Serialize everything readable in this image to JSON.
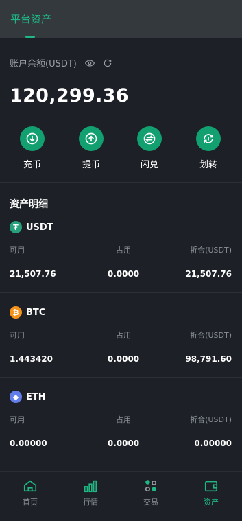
{
  "topbar": {
    "title": "平台资产"
  },
  "balance": {
    "label": "账户余额(USDT)",
    "amount": "120,299.36"
  },
  "actions": [
    {
      "label": "充币",
      "icon": "deposit-icon"
    },
    {
      "label": "提币",
      "icon": "withdraw-icon"
    },
    {
      "label": "闪兑",
      "icon": "swap-icon"
    },
    {
      "label": "划转",
      "icon": "transfer-icon"
    }
  ],
  "section": {
    "title": "资产明细"
  },
  "columns": {
    "available": "可用",
    "occupied": "占用",
    "converted": "折合(USDT)"
  },
  "assets": [
    {
      "symbol": "USDT",
      "color": "#26a17b",
      "glyph": "₮",
      "available": "21,507.76",
      "occupied": "0.0000",
      "converted": "21,507.76"
    },
    {
      "symbol": "BTC",
      "color": "#f7931a",
      "glyph": "₿",
      "available": "1.443420",
      "occupied": "0.0000",
      "converted": "98,791.60"
    },
    {
      "symbol": "ETH",
      "color": "#627eea",
      "glyph": "◆",
      "available": "0.00000",
      "occupied": "0.0000",
      "converted": "0.00000"
    }
  ],
  "nav": [
    {
      "label": "首页",
      "icon": "home-icon",
      "active": false
    },
    {
      "label": "行情",
      "icon": "chart-icon",
      "active": false
    },
    {
      "label": "交易",
      "icon": "trade-icon",
      "active": false
    },
    {
      "label": "资产",
      "icon": "wallet-icon",
      "active": true
    }
  ],
  "colors": {
    "accent": "#1fb884",
    "background": "#1d2026",
    "header": "#34393d"
  }
}
